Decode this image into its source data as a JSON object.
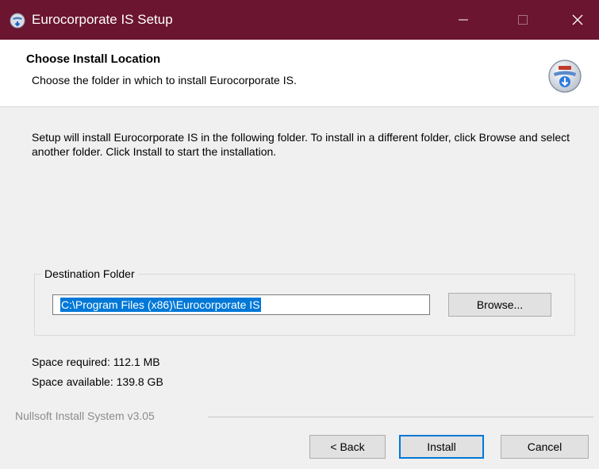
{
  "window": {
    "title": "Eurocorporate IS Setup",
    "title_bar_color": "#6b1530",
    "icon": "installer-globe-icon",
    "controls": [
      "minimize-icon",
      "maximize-icon",
      "close-icon"
    ]
  },
  "header": {
    "title": "Choose Install Location",
    "subtitle": "Choose the folder in which to install Eurocorporate IS.",
    "icon": "installer-globe-icon"
  },
  "body": {
    "intro_text": "Setup will install Eurocorporate IS in the following folder. To install in a different folder, click Browse and select another folder. Click Install to start the installation.",
    "destination_group_label": "Destination Folder",
    "destination_path": "C:\\Program Files (x86)\\Eurocorporate IS",
    "browse_label": "Browse...",
    "space_required": "Space required: 112.1 MB",
    "space_available": "Space available: 139.8 GB"
  },
  "footer": {
    "branding": "Nullsoft Install System v3.05",
    "back_label": "< Back",
    "install_label": "Install",
    "cancel_label": "Cancel",
    "focus_color": "#0078d7"
  }
}
